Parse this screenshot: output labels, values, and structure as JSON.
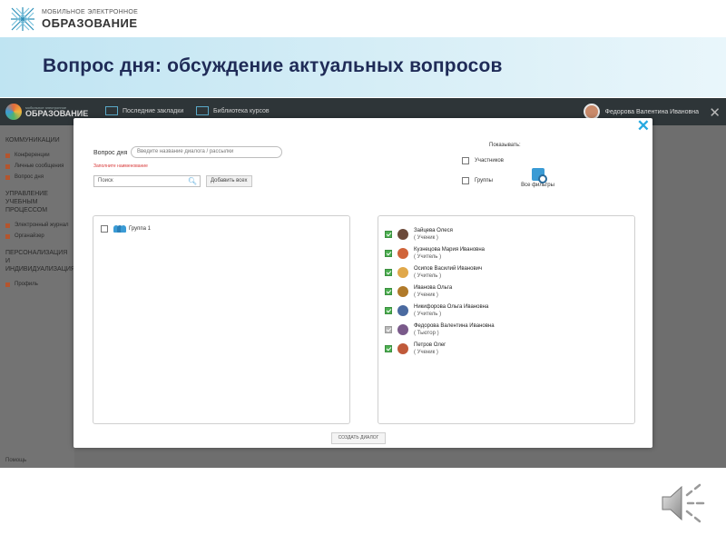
{
  "slide": {
    "brand_line1": "МОБИЛЬНОЕ ЭЛЕКТРОННОЕ",
    "brand_line2": "ОБРАЗОВАНИЕ",
    "title": "Вопрос дня: обсуждение актуальных вопросов"
  },
  "app": {
    "logo_line1": "мобильное электронное",
    "logo_line2": "ОБРАЗОВАНИЕ",
    "tabs": [
      "Последние закладки",
      "Библиотека курсов"
    ],
    "user_name": "Федорова Валентина Ивановна",
    "close_glyph": "✕",
    "sidebar": {
      "section1": "КОММУНИКАЦИИ",
      "section1_items": [
        "Конференции",
        "Личные сообщения",
        "Вопрос дня"
      ],
      "section2": "УПРАВЛЕНИЕ УЧЕБНЫМ ПРОЦЕССОМ",
      "section2_items": [
        "Электронный журнал",
        "Органайзер"
      ],
      "section3": "ПЕРСОНАЛИЗАЦИЯ И ИНДИВИДУАЛИЗАЦИЯ",
      "section3_items": [
        "Профиль"
      ]
    },
    "footer": "Помощь"
  },
  "dialog": {
    "close_glyph": "✕",
    "topic_label": "Вопрос дня",
    "topic_placeholder": "Введите название диалога / рассылки",
    "warning": "Заполните наименование",
    "search_placeholder": "Поиск",
    "add_all": "Добавить всех",
    "show_label": "Показывать:",
    "show_options": [
      "Участников",
      "Группы"
    ],
    "all_filters": "Все фильтры",
    "group_name": "Группа 1",
    "participants": [
      {
        "name": "Зайцева Олеся",
        "role": "( Ученик )",
        "color": "#6b4a3a"
      },
      {
        "name": "Кузнецова Мария Ивановна",
        "role": "( Учитель )",
        "color": "#d0643a"
      },
      {
        "name": "Осипов Василий Иванович",
        "role": "( Учитель )",
        "color": "#e0a84a"
      },
      {
        "name": "Иванова Ольга",
        "role": "( Ученик )",
        "color": "#b07a2a"
      },
      {
        "name": "Никифорова Ольга Ивановна",
        "role": "( Учитель )",
        "color": "#4a6aa0"
      },
      {
        "name": "Федорова Валентина Ивановна",
        "role": "( Тьютор )",
        "color": "#7a5a8a"
      },
      {
        "name": "Петров Олег",
        "role": "( Ученик )",
        "color": "#c05a3a"
      }
    ],
    "create_button": "СОЗДАТЬ ДИАЛОГ"
  }
}
